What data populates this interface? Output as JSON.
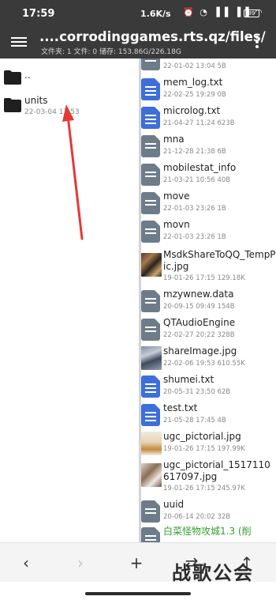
{
  "status_bar": {
    "time": "17:59",
    "speed": "1.6K/s",
    "battery": "89"
  },
  "header": {
    "path": "....corrodinggames.rts.qz/files/",
    "info": "文件夹: 1  文件: 0  储存: 153.86G/226.18G"
  },
  "left_pane": {
    "items": [
      {
        "name": "..",
        "meta": ""
      },
      {
        "name": "units",
        "meta": "22-03-04 17:53"
      }
    ]
  },
  "right_pane": {
    "files": [
      {
        "name": "",
        "meta": "22-01-02 13:04  5B",
        "icon": "file-icon"
      },
      {
        "name": "mem_log.txt",
        "meta": "22-02-25 19:29  0B",
        "icon": "text-file-icon"
      },
      {
        "name": "microlog.txt",
        "meta": "21-04-27 11:24  623B",
        "icon": "text-file-icon"
      },
      {
        "name": "mna",
        "meta": "21-12-28 21:38  6B",
        "icon": "file-icon"
      },
      {
        "name": "mobilestat_info",
        "meta": "21-03-21 10:56  40B",
        "icon": "file-icon"
      },
      {
        "name": "move",
        "meta": "22-01-03 23:26  1B",
        "icon": "file-icon"
      },
      {
        "name": "movn",
        "meta": "22-01-03 23:26  1B",
        "icon": "file-icon"
      },
      {
        "name": "MsdkShareToQQ_TempPic.jpg",
        "meta": "19-01-26 17:15  129.18K",
        "icon": "image-thumbnail"
      },
      {
        "name": "mzywnew.data",
        "meta": "20-09-15 09:49  154B",
        "icon": "file-icon"
      },
      {
        "name": "QTAudioEngine",
        "meta": "22-02-27 20:22  328B",
        "icon": "file-icon"
      },
      {
        "name": "shareImage.jpg",
        "meta": "22-02-06 19:53  610.55K",
        "icon": "image-thumbnail"
      },
      {
        "name": "shumei.txt",
        "meta": "20-05-31 23:50  62B",
        "icon": "text-file-icon"
      },
      {
        "name": "test.txt",
        "meta": "21-05-28 17:45  4B",
        "icon": "text-file-icon"
      },
      {
        "name": "ugc_pictorial.jpg",
        "meta": "19-01-26 17:15  197.99K",
        "icon": "image-thumbnail"
      },
      {
        "name": "ugc_pictorial_1517110617097.jpg",
        "meta": "19-01-26 17:15  245.97K",
        "icon": "image-thumbnail"
      },
      {
        "name": "uuid",
        "meta": "20-06-14 20:02  32B",
        "icon": "file-icon"
      },
      {
        "name": "白菜怪物攻城1.3 (削",
        "meta": "",
        "icon": "file-icon"
      }
    ]
  },
  "bottom_bar": {
    "back": "‹",
    "forward": "›",
    "add": "+",
    "swap": "⇄",
    "up": "↑"
  },
  "watermark": "战歌公会",
  "colors": {
    "bar": "#3a3a3a",
    "doc_icon": "#3d6fd8",
    "file_icon": "#6e7c8a",
    "annotation_arrow": "#e53935",
    "green_text": "#33a02c"
  }
}
